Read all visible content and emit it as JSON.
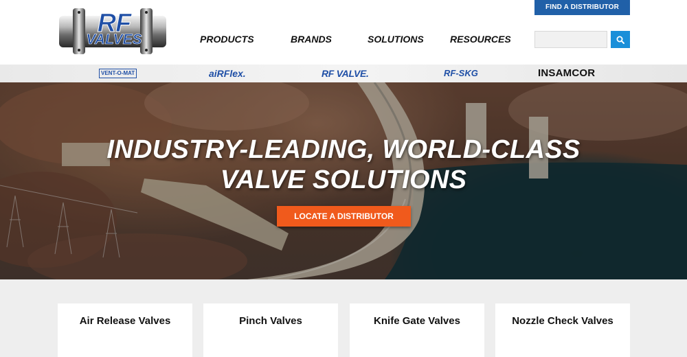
{
  "header": {
    "logo": {
      "line1": "RF",
      "line2": "VALVES"
    },
    "nav": [
      "PRODUCTS",
      "BRANDS",
      "SOLUTIONS",
      "RESOURCES"
    ],
    "find_distributor_label": "FIND A DISTRIBUTOR",
    "search": {
      "value": "",
      "placeholder": ""
    },
    "search_icon": "search-icon"
  },
  "brands": [
    "VENT-O-MAT",
    "aiRFlex.",
    "RF VALVE.",
    "RF-SKG",
    "INSAMCOR"
  ],
  "hero": {
    "heading_line1": "INDUSTRY-LEADING, WORLD-CLASS",
    "heading_line2": "VALVE SOLUTIONS",
    "cta_label": "LOCATE A DISTRIBUTOR"
  },
  "cards": [
    "Air Release Valves",
    "Pinch Valves",
    "Knife Gate Valves",
    "Nozzle Check Valves"
  ],
  "colors": {
    "brand_blue": "#2060a8",
    "search_blue": "#1a8fd9",
    "cta_orange": "#f05a1c",
    "logo_blue": "#1f4fa6"
  }
}
